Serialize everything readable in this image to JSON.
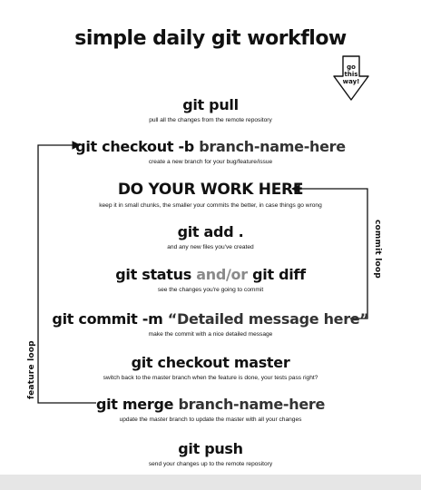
{
  "title": "simple daily git workflow",
  "direction_arrow": {
    "text_lines": [
      "go",
      "this",
      "way!"
    ],
    "icon": "down-arrow-icon"
  },
  "steps": [
    {
      "cmd": "git pull",
      "desc": "pull all the changes from the remote repository"
    },
    {
      "cmd_a": "git checkout -b",
      "cmd_b": "branch-name-here",
      "desc": "create a new branch for your bug/feature/issue"
    },
    {
      "cmd": "DO YOUR WORK HERE",
      "desc": "keep it in small chunks, the smaller your commits the better, in case things go wrong"
    },
    {
      "cmd": "git add .",
      "desc": "and any new files you've created"
    },
    {
      "cmd_a": "git status",
      "cmd_mid": "and/or",
      "cmd_b": "git diff",
      "desc": "see the changes you're going to commit"
    },
    {
      "cmd_a": "git commit -m",
      "cmd_b": "“Detailed message here”",
      "desc": "make the commit with a nice detailed message"
    },
    {
      "cmd": "git checkout master",
      "desc": "switch back to the master branch when the feature is done, your tests pass right?"
    },
    {
      "cmd_a": "git merge",
      "cmd_b": "branch-name-here",
      "desc": "update the master branch to update the master with all your changes"
    },
    {
      "cmd": "git push",
      "desc": "send your changes up to the remote repository"
    }
  ],
  "loops": {
    "commit": "commit loop",
    "feature": "feature loop"
  }
}
